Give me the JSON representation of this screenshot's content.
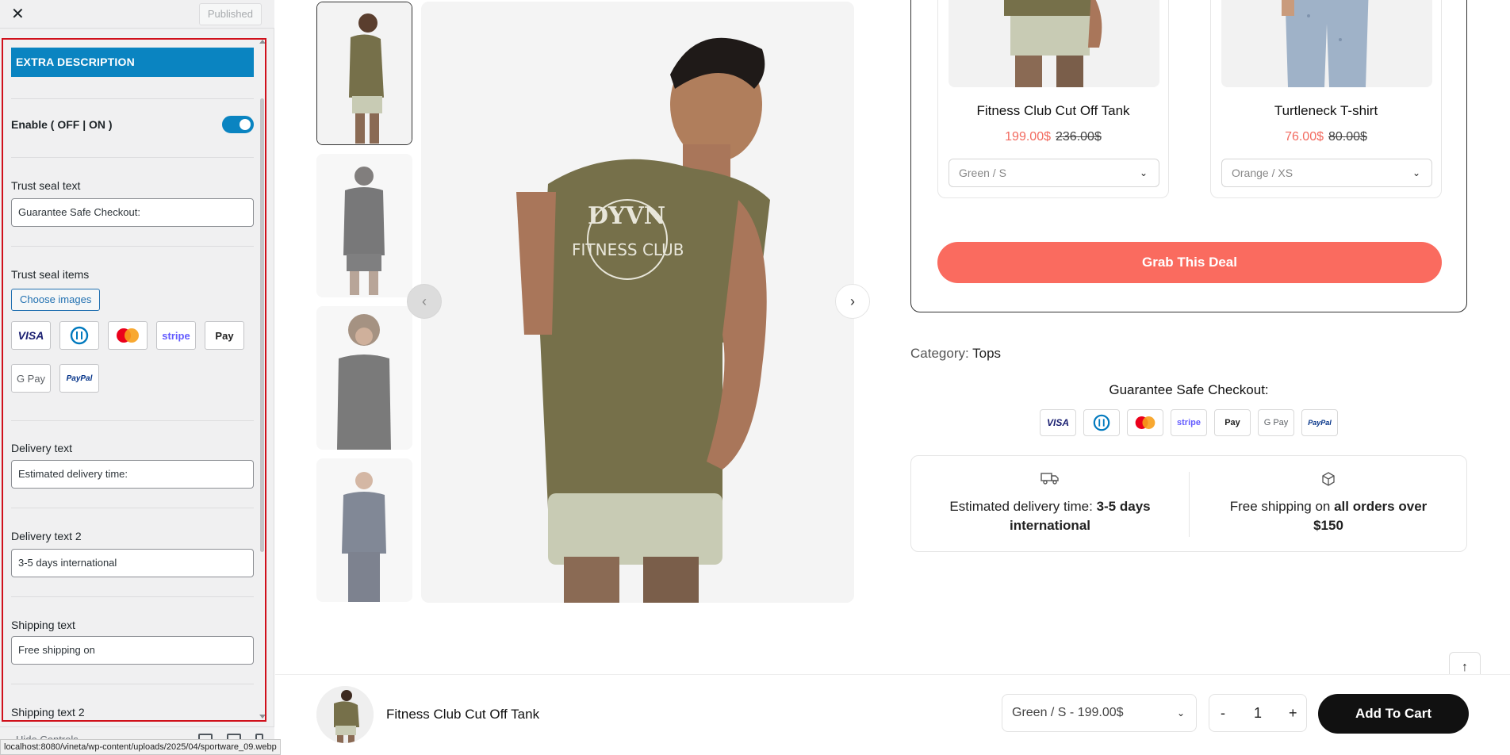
{
  "customizer": {
    "published_label": "Published",
    "section_title": "EXTRA DESCRIPTION",
    "enable_label": "Enable ( OFF | ON )",
    "enable_on": true,
    "trust_seal_text_label": "Trust seal text",
    "trust_seal_text_value": "Guarantee Safe Checkout:",
    "trust_seal_items_label": "Trust seal items",
    "choose_images_label": "Choose images",
    "payment_icons": [
      "visa-icon",
      "diners-icon",
      "mastercard-icon",
      "stripe-icon",
      "apple-pay-icon",
      "google-pay-icon",
      "paypal-icon"
    ],
    "delivery_text_label": "Delivery text",
    "delivery_text_value": "Estimated delivery time:",
    "delivery_text2_label": "Delivery text 2",
    "delivery_text2_value": "3-5 days international",
    "shipping_text_label": "Shipping text",
    "shipping_text_value": "Free shipping on",
    "shipping_text2_label": "Shipping text 2",
    "hide_controls_label": "Hide Controls"
  },
  "status_url": "localhost:8080/vineta/wp-content/uploads/2025/04/sportware_09.webp",
  "product": {
    "deal_items": [
      {
        "name": "Fitness Club Cut Off Tank",
        "price": "199.00$",
        "old_price": "236.00$",
        "variant": "Green / S"
      },
      {
        "name": "Turtleneck T-shirt",
        "price": "76.00$",
        "old_price": "80.00$",
        "variant": "Orange / XS"
      }
    ],
    "grab_deal_label": "Grab This Deal",
    "category_label": "Category:",
    "category_value": "Tops",
    "guarantee_text": "Guarantee Safe Checkout:",
    "delivery_text": "Estimated delivery time:",
    "delivery_text_bold": "3-5 days international",
    "shipping_text": "Free shipping on",
    "shipping_text_bold": "all orders over $150"
  },
  "sticky_bar": {
    "product_name": "Fitness Club Cut Off Tank",
    "variant": "Green / S - 199.00$",
    "qty_minus": "-",
    "qty_value": "1",
    "qty_plus": "+",
    "add_to_cart": "Add To Cart"
  },
  "colors": {
    "accent_blue": "#0a84c1",
    "deal_button": "#fa6b5f",
    "sale_price": "#f26a5f",
    "highlight_border": "#d0101b"
  }
}
